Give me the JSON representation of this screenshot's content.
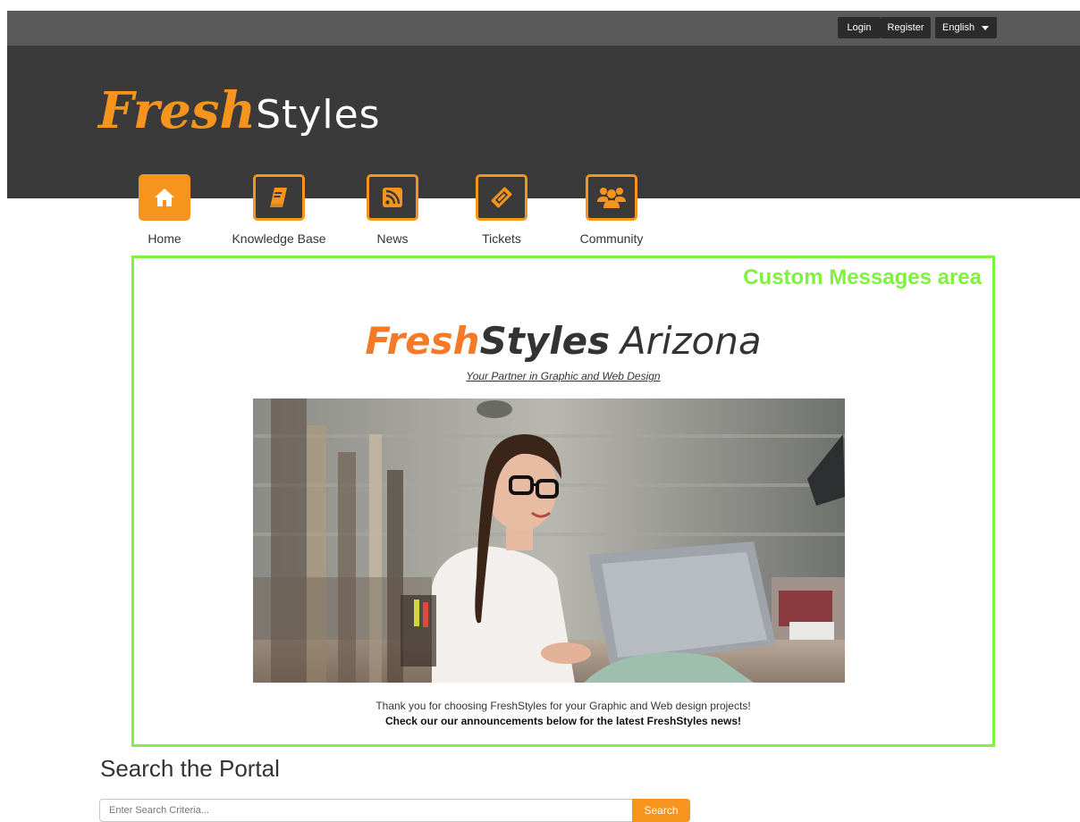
{
  "topbar": {
    "login_label": "Login",
    "register_label": "Register",
    "language_selected": "English"
  },
  "logo": {
    "part1": "Fresh",
    "part2": "Styles"
  },
  "nav": {
    "items": [
      {
        "label": "Home",
        "icon": "home-icon",
        "active": true
      },
      {
        "label": "Knowledge Base",
        "icon": "book-icon",
        "active": false
      },
      {
        "label": "News",
        "icon": "rss-icon",
        "active": false
      },
      {
        "label": "Tickets",
        "icon": "ticket-icon",
        "active": false
      },
      {
        "label": "Community",
        "icon": "users-icon",
        "active": false
      }
    ]
  },
  "custom_message": {
    "area_label": "Custom Messages area",
    "brand_fresh": "Fresh",
    "brand_styles": "Styles",
    "brand_location": "Arizona",
    "tagline": "Your Partner in Graphic and Web Design",
    "thanks_line": "Thank you for choosing FreshStyles for your Graphic and Web design projects!",
    "announcement_line": "Check our our announcements below for the latest FreshStyles news!"
  },
  "search": {
    "title": "Search the Portal",
    "placeholder": "Enter Search Criteria...",
    "button_label": "Search"
  },
  "colors": {
    "accent": "#f7941d",
    "frame_highlight": "#7ef23c",
    "header_bg": "#3a3a3a",
    "topbar_bg": "#5a5a5a"
  }
}
